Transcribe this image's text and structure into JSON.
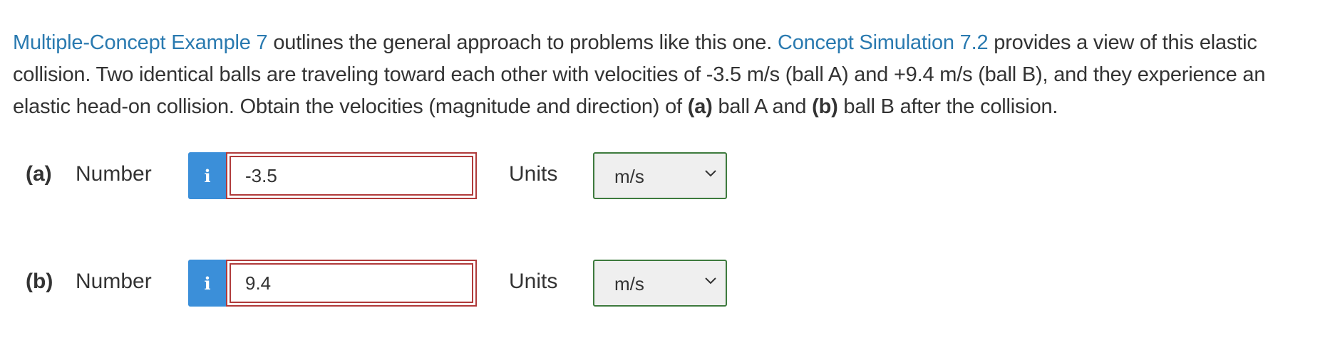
{
  "question": {
    "link1": "Multiple-Concept Example 7",
    "text1": " outlines the general approach to problems like this one. ",
    "link2": "Concept Simulation 7.2",
    "text2": " provides a view of this elastic collision. Two identical balls are traveling toward each other with velocities of -3.5 m/s (ball A) and +9.4 m/s (ball B), and they experience an elastic head-on collision. Obtain the velocities (magnitude and direction) of ",
    "bold_a": "(a)",
    "text3": " ball A and ",
    "bold_b": "(b)",
    "text4": " ball B after the collision."
  },
  "answers": [
    {
      "part_label": "(a)",
      "number_label": "Number",
      "info_icon": "i",
      "value": "-3.5",
      "units_label": "Units",
      "unit_selected": "m/s"
    },
    {
      "part_label": "(b)",
      "number_label": "Number",
      "info_icon": "i",
      "value": "9.4",
      "units_label": "Units",
      "unit_selected": "m/s"
    }
  ],
  "colors": {
    "link": "#2a7ab0",
    "info_button": "#3b8fd9",
    "input_border": "#b03a3a",
    "select_border": "#3d7a3d"
  },
  "icons": {
    "info": "info-icon",
    "dropdown": "chevron-down-icon"
  }
}
